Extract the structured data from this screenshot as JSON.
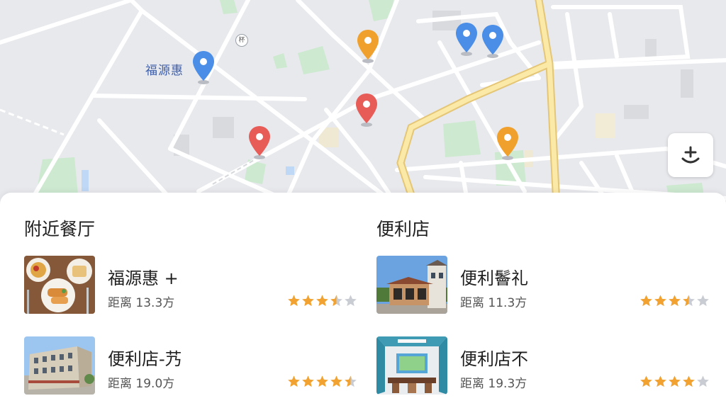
{
  "map": {
    "label_fuyuanhui": "福源惠",
    "road_number": "杯",
    "zoom_button_label": "±"
  },
  "sections": [
    {
      "title": "附近餐厅",
      "items": [
        {
          "name": "福源惠 +",
          "distance": "距离 13.3方",
          "rating": 3.5,
          "thumb": "food"
        },
        {
          "name": "便利店-艿",
          "distance": "距离 19.0方",
          "rating": 4.5,
          "thumb": "building"
        }
      ]
    },
    {
      "title": "便利店",
      "items": [
        {
          "name": "便利鬠礼",
          "distance": "距离 11.3方",
          "rating": 3.5,
          "thumb": "store"
        },
        {
          "name": "便利店不",
          "distance": "距离 19.3方",
          "rating": 4,
          "thumb": "interior"
        }
      ]
    }
  ],
  "colors": {
    "pin_blue": "#4a8ee8",
    "pin_orange": "#f0a02c",
    "pin_red": "#e85c58",
    "star_filled": "#f2a230",
    "star_empty": "#c9cdd3"
  },
  "icons": [
    "map-pin-icon",
    "zoom-control-icon",
    "star-icon"
  ]
}
